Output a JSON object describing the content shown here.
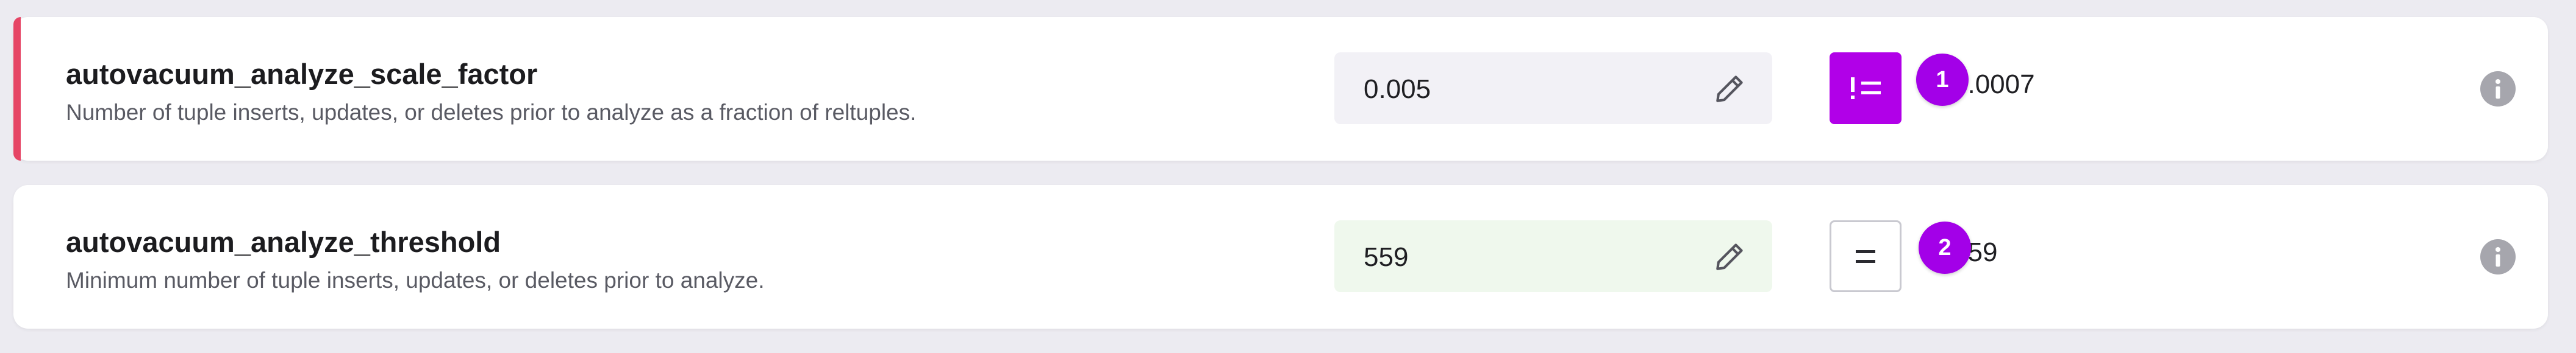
{
  "settings": [
    {
      "name": "autovacuum_analyze_scale_factor",
      "description": "Number of tuple inserts, updates, or deletes prior to analyze as a fraction of reltuples.",
      "current_value": "0.005",
      "recommended_value": "0.0007",
      "badge": "1",
      "changed": true,
      "diff_icon": "not-equal-icon",
      "accent_color": "#e64565"
    },
    {
      "name": "autovacuum_analyze_threshold",
      "description": "Minimum number of tuple inserts, updates, or deletes prior to analyze.",
      "current_value": "559",
      "recommended_value": "559",
      "badge": "2",
      "changed": false,
      "diff_icon": "equal-icon"
    }
  ],
  "colors": {
    "accent_purple": "#b100e8",
    "badge_purple": "#a300e8",
    "changed_marker": "#e64565"
  }
}
